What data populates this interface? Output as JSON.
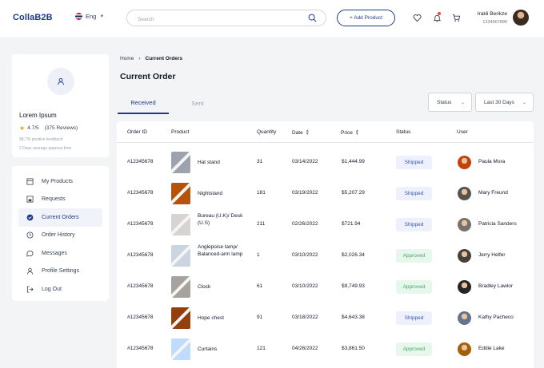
{
  "brand": "CollaB2B",
  "header": {
    "language": "Eng",
    "search_placeholder": "Search",
    "add_product": "+ Add Product",
    "user_name": "Irakli Berikze",
    "user_phone": "1234567890"
  },
  "profile": {
    "name": "Lorem Ipsum",
    "rating": "4.7/5",
    "reviews": "(375 Reviews)",
    "feedback": "98,7% positive feedback",
    "approve_time": "2 Days average approve time"
  },
  "nav": [
    {
      "label": "My Products",
      "icon": "grid-icon"
    },
    {
      "label": "Requests",
      "icon": "inbox-icon"
    },
    {
      "label": "Current Orders",
      "icon": "check-circle-icon",
      "active": true
    },
    {
      "label": "Order History",
      "icon": "clock-icon"
    },
    {
      "label": "Messages",
      "icon": "message-icon"
    },
    {
      "label": "Profile Settings",
      "icon": "user-icon"
    },
    {
      "label": "Log Out",
      "icon": "logout-icon"
    }
  ],
  "breadcrumb": {
    "home": "Home",
    "current": "Current Orders"
  },
  "page_title": "Current Order",
  "tabs": {
    "received": "Received",
    "sent": "Sent"
  },
  "filters": {
    "status": "Status",
    "date": "Last 30 Days"
  },
  "table": {
    "headers": {
      "order_id": "Order ID",
      "product": "Product",
      "quantity": "Quantity",
      "date": "Date",
      "price": "Price",
      "status": "Status",
      "user": "User"
    },
    "rows": [
      {
        "order_id": "#12345678",
        "product": "Hat stand",
        "quantity": "31",
        "date": "03/14/2022",
        "price": "$1,444.99",
        "status": "Shipped",
        "user": "Paula Mora",
        "thumb_color": "#9ca3af",
        "avatar_color": "#c2410c"
      },
      {
        "order_id": "#12345678",
        "product": "Nightstand",
        "quantity": "181",
        "date": "03/19/2022",
        "price": "$5,207.29",
        "status": "Shipped",
        "user": "Mary Freund",
        "thumb_color": "#b45309",
        "avatar_color": "#57534e"
      },
      {
        "order_id": "#12345678",
        "product": "Bureau (U.K)/ Desk (U.S)",
        "quantity": "211",
        "date": "02/26/2022",
        "price": "$721.94",
        "status": "Shipped",
        "user": "Patricia Sanders",
        "thumb_color": "#d6d3d1",
        "avatar_color": "#78716c"
      },
      {
        "order_id": "#12345678",
        "product": "Anglepoise lamp/ Balanced-arm lamp",
        "quantity": "1",
        "date": "03/10/2022",
        "price": "$2,026.34",
        "status": "Approved",
        "user": "Jerry Helfer",
        "thumb_color": "#cbd5e1",
        "avatar_color": "#44403c"
      },
      {
        "order_id": "#12345678",
        "product": "Clock",
        "quantity": "61",
        "date": "03/10/2022",
        "price": "$9,749.93",
        "status": "Approved",
        "user": "Bradley Lawlor",
        "thumb_color": "#a8a29e",
        "avatar_color": "#292524"
      },
      {
        "order_id": "#12345678",
        "product": "Hope chest",
        "quantity": "91",
        "date": "03/18/2022",
        "price": "$4,643.38",
        "status": "Shipped",
        "user": "Kathy Pacheco",
        "thumb_color": "#92400e",
        "avatar_color": "#64748b"
      },
      {
        "order_id": "#12345678",
        "product": "Curtains",
        "quantity": "121",
        "date": "04/26/2022",
        "price": "$3,861.50",
        "status": "Approved",
        "user": "Eddie Lake",
        "thumb_color": "#bfdbfe",
        "avatar_color": "#a16207"
      }
    ]
  },
  "colors": {
    "brand": "#1e3a8a",
    "shipped_bg": "#eef1fb",
    "approved_bg": "#e7f7ec"
  }
}
